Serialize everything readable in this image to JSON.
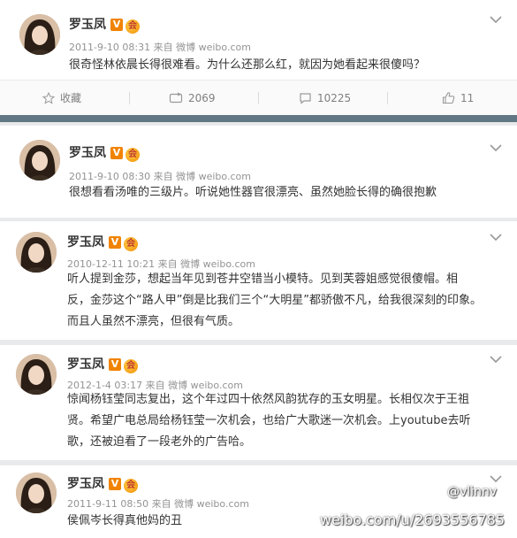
{
  "posts": [
    {
      "name": "罗玉凤",
      "badge": "V",
      "medal": "会",
      "meta": "2011-9-10 08:31 来自 微博 weibo.com",
      "text": [
        "很奇怪林依晨长得很难看。为什么还那么红，就因为她看起来很傻吗？"
      ]
    },
    {
      "name": "罗玉凤",
      "badge": "V",
      "medal": "会",
      "meta": "2011-9-10 08:30 来自 微博 weibo.com",
      "text": [
        "很想看看汤唯的三级片。听说她性器官很漂亮、虽然她脸长得的确很抱歉"
      ]
    },
    {
      "name": "罗玉凤",
      "badge": "V",
      "medal": "会",
      "meta": "2010-12-11 10:21 来自 微博 weibo.com",
      "text": [
        "听人提到金莎，想起当年见到苍井空错当小模特。见到芙蓉姐感觉很傻帽。相",
        "反，金莎这个“路人甲”倒是比我们三个“大明星”都骄傲不凡，给我很深刻的印象。",
        "而且人虽然不漂亮，但很有气质。"
      ]
    },
    {
      "name": "罗玉凤",
      "badge": "V",
      "medal": "会",
      "meta": "2012-1-4 03:17 来自 微博 weibo.com",
      "text": [
        "惊闻杨钰莹同志复出，这个年过四十依然风韵犹存的玉女明星。长相仅次于王祖",
        "贤。希望广电总局给杨钰莹一次机会，也给广大歌迷一次机会。上youtube去听",
        "歌，还被迫看了一段老外的广告哈。"
      ]
    },
    {
      "name": "罗玉凤",
      "badge": "V",
      "medal": "会",
      "meta": "2011-9-11 08:50 来自 微博 weibo.com",
      "text": [
        "侯佩岑长得真他妈的丑"
      ]
    }
  ],
  "toolbar": {
    "favorite_label": "收藏",
    "repost_count": "2069",
    "comment_count": "10225",
    "like_count": "11"
  },
  "watermark": {
    "handle": "@vlinnv",
    "url": "weibo.com/u/2693556785"
  },
  "colors": {
    "divider_bar": "#617884",
    "badge": "#f08300",
    "meta": "#939393"
  }
}
